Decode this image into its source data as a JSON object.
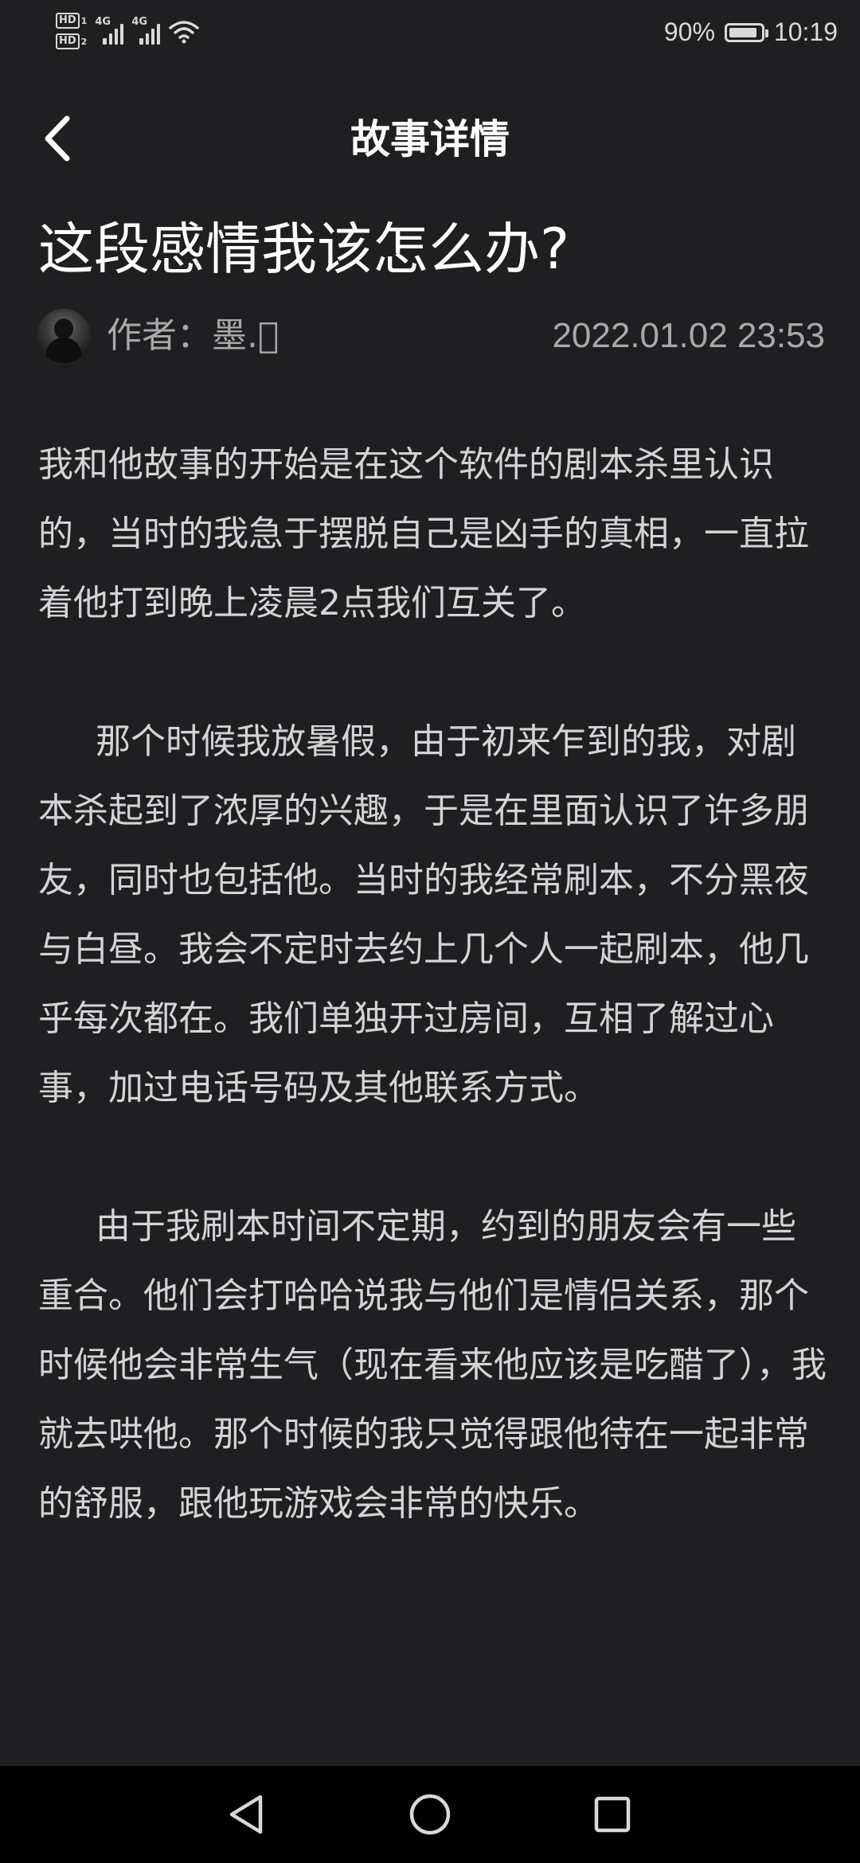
{
  "status_bar": {
    "hd1": "HD",
    "hd1_num": "1",
    "hd2": "HD",
    "hd2_num": "2",
    "signal1_label": "4G",
    "signal2_label": "4G",
    "battery_percent": "90%",
    "battery_level": 0.9,
    "time": "10:19"
  },
  "header": {
    "back_icon": "chevron-left-icon",
    "title": "故事详情"
  },
  "article": {
    "title": "这段感情我该怎么办?",
    "author": "作者：墨.\u0000",
    "date": "2022.01.02 23:53",
    "paragraphs": [
      "我和他故事的开始是在这个软件的剧本杀里认识的，当时的我急于摆脱自己是凶手的真相，一直拉着他打到晚上凌晨2点我们互关了。",
      "那个时候我放暑假，由于初来乍到的我，对剧本杀起到了浓厚的兴趣，于是在里面认识了许多朋友，同时也包括他。当时的我经常刷本，不分黑夜与白昼。我会不定时去约上几个人一起刷本，他几乎每次都在。我们单独开过房间，互相了解过心事，加过电话号码及其他联系方式。",
      "由于我刷本时间不定期，约到的朋友会有一些重合。他们会打哈哈说我与他们是情侣关系，那个时候他会非常生气（现在看来他应该是吃醋了），我就去哄他。那个时候的我只觉得跟他待在一起非常的舒服，跟他玩游戏会非常的快乐。"
    ]
  },
  "nav_bar": {
    "back_icon": "triangle-back-icon",
    "home_icon": "circle-home-icon",
    "recent_icon": "square-recents-icon"
  }
}
